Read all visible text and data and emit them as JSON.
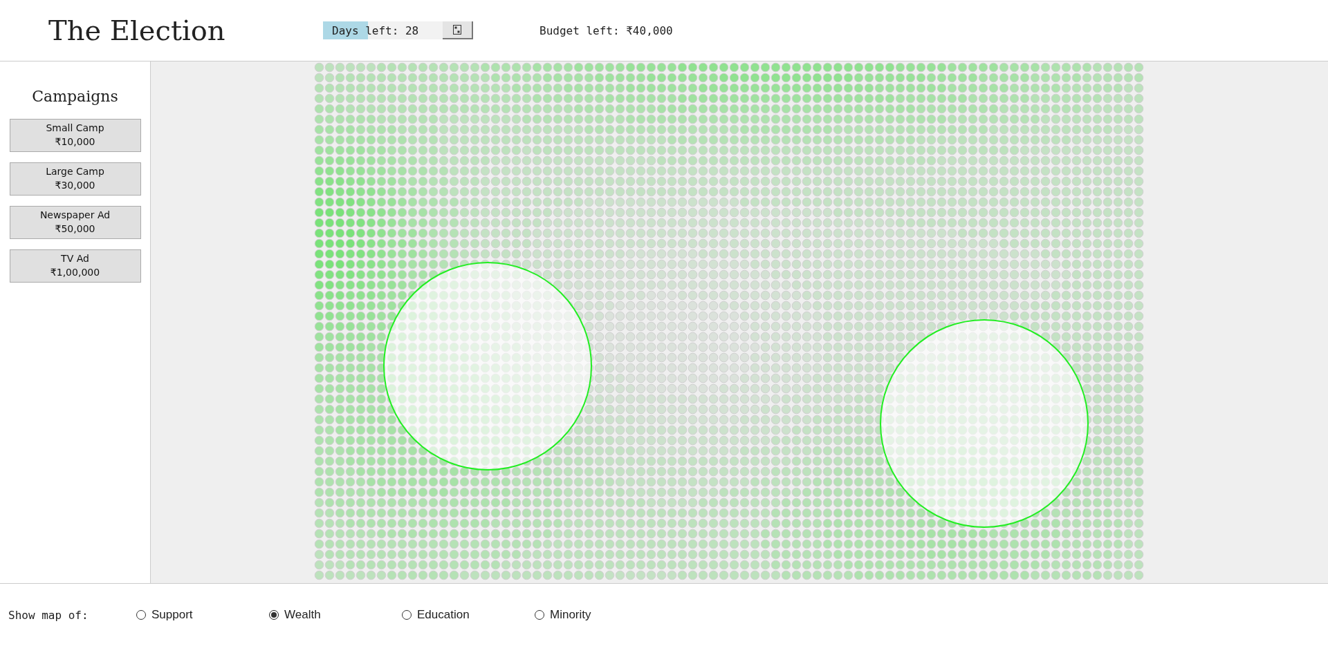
{
  "header": {
    "title": "The Election",
    "days": {
      "label": "Days left: 28",
      "level": 0.3
    },
    "budget": "Budget left: ₹40,000"
  },
  "sidebar": {
    "title": "Campaigns",
    "campaigns": [
      {
        "name": "Small Camp",
        "price": "₹10,000"
      },
      {
        "name": "Large Camp",
        "price": "₹30,000"
      },
      {
        "name": "Newspaper Ad",
        "price": "₹50,000"
      },
      {
        "name": "TV Ad",
        "price": "₹1,00,000"
      }
    ]
  },
  "map_options": {
    "label": "Show map of:",
    "options": [
      {
        "label": "Support",
        "selected": false
      },
      {
        "label": "Wealth",
        "selected": true
      },
      {
        "label": "Education",
        "selected": false
      },
      {
        "label": "Minority",
        "selected": false
      }
    ]
  }
}
